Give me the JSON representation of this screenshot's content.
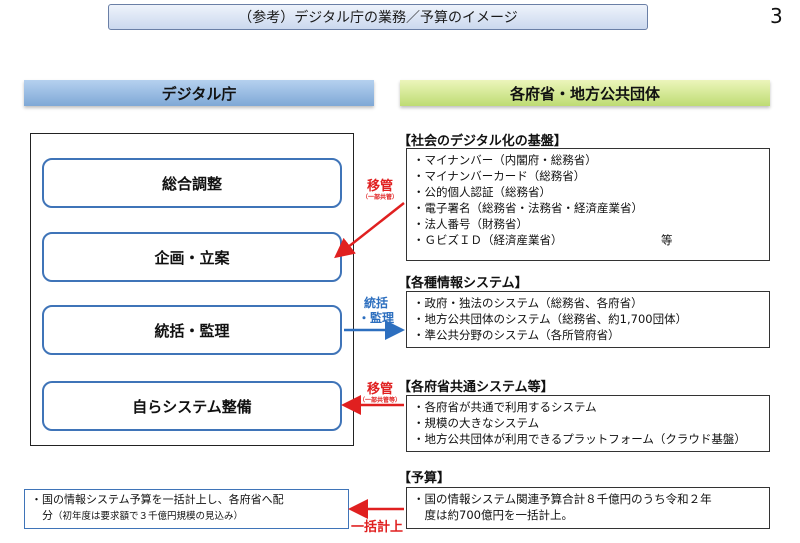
{
  "header": {
    "title": "（参考）デジタル庁の業務／予算のイメージ",
    "page_number": "3"
  },
  "left_column": {
    "header": "デジタル庁",
    "roles": [
      "総合調整",
      "企画・立案",
      "統括・監理",
      "自らシステム整備"
    ]
  },
  "right_column": {
    "header": "各府省・地方公共団体",
    "sections": [
      {
        "title": "【社会のデジタル化の基盤】",
        "items": [
          "・マイナンバー（内閣府・総務省）",
          "・マイナンバーカード（総務省）",
          "・公的個人認証（総務省）",
          "・電子署名（総務省・法務省・経済産業省）",
          "・法人番号（財務省）",
          "・ＧビズＩＤ（経済産業省）"
        ],
        "last_item_suffix": "等"
      },
      {
        "title": "【各種情報システム】",
        "items": [
          "・政府・独法のシステム（総務省、各府省）",
          "・地方公共団体のシステム（総務省、約1,700団体）",
          "・準公共分野のシステム（各所管府省）"
        ]
      },
      {
        "title": "【各府省共通システム等】",
        "items": [
          "・各府省が共通で利用するシステム",
          "・規模の大きなシステム",
          "・地方公共団体が利用できるプラットフォーム（クラウド基盤）"
        ]
      },
      {
        "title": "【予算】",
        "items": [
          "・国の情報システム関連予算合計８千億円のうち令和２年",
          "　度は約700億円を一括計上。"
        ]
      }
    ]
  },
  "connectors": {
    "transfer_1": {
      "main": "移管",
      "sub": "（一部共管）"
    },
    "oversight": {
      "line1": "統括",
      "line2": "・監理"
    },
    "transfer_2": {
      "main": "移管",
      "sub": "（一部共管等）"
    },
    "budget": "一括計上"
  },
  "budget_left": {
    "line1": "・国の情報システム予算を一括計上し、各府省へ配",
    "line2_main": "　分",
    "line2_note": "（初年度は要求額で３千億円規模の見込み）"
  },
  "colors": {
    "red": "#e02020",
    "blue": "#2d6fbf",
    "box_border": "#3f74b8"
  }
}
